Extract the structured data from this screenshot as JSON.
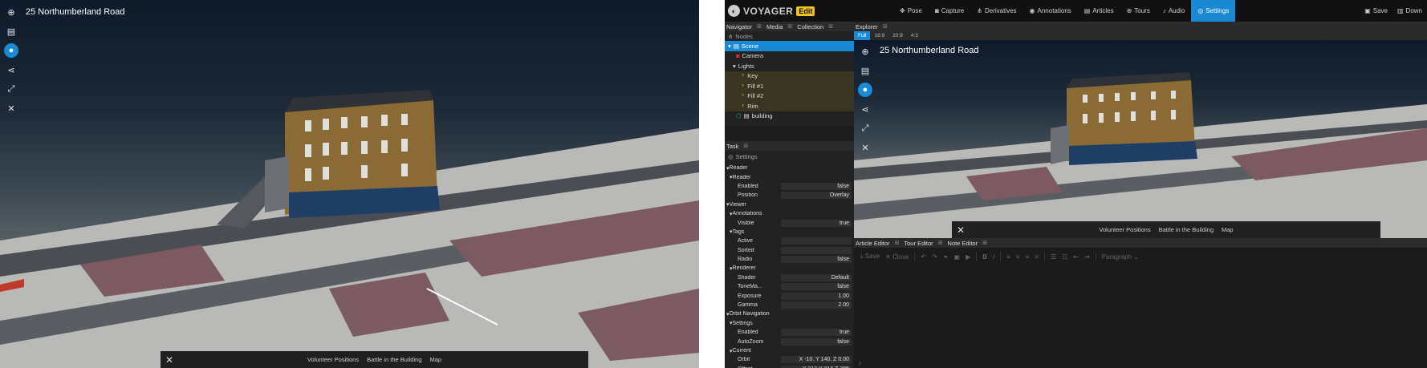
{
  "viewer": {
    "title": "25 Northumberland Road",
    "tools": [
      "globe-icon",
      "document-icon",
      "chat-icon",
      "share-icon",
      "fullscreen-icon",
      "tools-icon"
    ],
    "tour_close": "✕",
    "tours": [
      "Volunteer Positions",
      "Battle in the Building",
      "Map"
    ]
  },
  "app": {
    "logo": "VOYAGER",
    "mode": "Edit",
    "menu": [
      {
        "label": "Pose",
        "icon": "move-icon"
      },
      {
        "label": "Capture",
        "icon": "camera-icon"
      },
      {
        "label": "Derivatives",
        "icon": "hierarchy-icon"
      },
      {
        "label": "Annotations",
        "icon": "comment-icon"
      },
      {
        "label": "Articles",
        "icon": "file-icon"
      },
      {
        "label": "Tours",
        "icon": "globe-icon"
      },
      {
        "label": "Audio",
        "icon": "audio-icon"
      },
      {
        "label": "Settings",
        "icon": "eye-icon"
      }
    ],
    "active_menu": "Settings",
    "save_label": "Save",
    "download_label": "Down"
  },
  "navigator": {
    "tabs": [
      "Navigator",
      "Media",
      "Collection"
    ],
    "nodes_label": "Nodes",
    "tree": [
      {
        "label": "Scene"
      },
      {
        "label": "Camera"
      },
      {
        "label": "Lights"
      },
      {
        "label": "Key"
      },
      {
        "label": "Fill #1"
      },
      {
        "label": "Fill #2"
      },
      {
        "label": "Rim"
      },
      {
        "label": "building"
      }
    ]
  },
  "task": {
    "tab": "Task",
    "settings_label": "Settings",
    "props": [
      {
        "label": "Reader",
        "value": ""
      },
      {
        "label": "Reader",
        "value": ""
      },
      {
        "label": "Enabled",
        "value": "false"
      },
      {
        "label": "Position",
        "value": "Overlay"
      },
      {
        "label": "Viewer",
        "value": ""
      },
      {
        "label": "Annotations",
        "value": ""
      },
      {
        "label": "Visible",
        "value": "true"
      },
      {
        "label": "Tags",
        "value": ""
      },
      {
        "label": "Active",
        "value": ""
      },
      {
        "label": "Sorted",
        "value": ""
      },
      {
        "label": "Radio",
        "value": "false"
      },
      {
        "label": "Renderer",
        "value": ""
      },
      {
        "label": "Shader",
        "value": "Default"
      },
      {
        "label": "ToneMa...",
        "value": "false"
      },
      {
        "label": "Exposure",
        "value": "1.00"
      },
      {
        "label": "Gamma",
        "value": "2.00"
      },
      {
        "label": "Orbit Navigation",
        "value": ""
      },
      {
        "label": "Settings",
        "value": ""
      },
      {
        "label": "Enabled",
        "value": "true"
      },
      {
        "label": "AutoZoom",
        "value": "false"
      },
      {
        "label": "Current",
        "value": ""
      },
      {
        "label": "Orbit",
        "value": "X -10. Y 140. Z 0.00"
      },
      {
        "label": "Offset",
        "value": "X 313 Y 212 Z 285"
      }
    ]
  },
  "explorer": {
    "tab": "Explorer",
    "ratios": [
      "Full",
      "16:9",
      "20:9",
      "4:3"
    ],
    "active_ratio": "Full"
  },
  "editor": {
    "tabs": [
      "Article Editor",
      "Tour Editor",
      "Note Editor"
    ],
    "save": "Save",
    "close": "Close",
    "paragraph": "Paragraph",
    "status": "p"
  }
}
